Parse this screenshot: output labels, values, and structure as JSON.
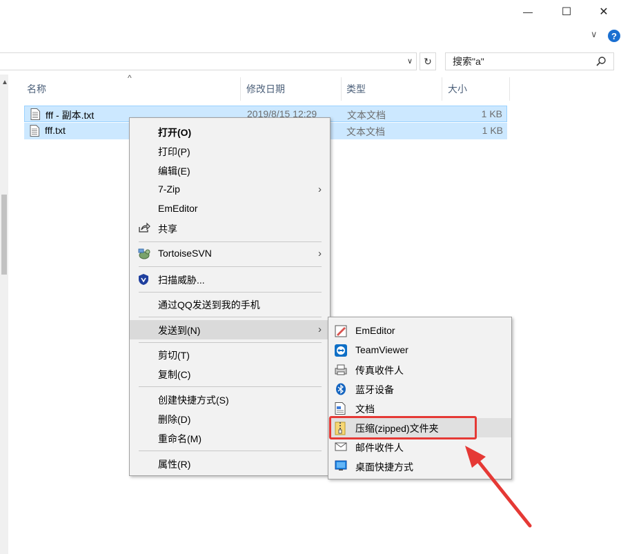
{
  "window": {
    "minimize_glyph": "—",
    "maximize_glyph": "☐",
    "close_glyph": "✕",
    "help_glyph": "?",
    "ribbon_toggle_glyph": "∨"
  },
  "toolbar": {
    "search_placeholder": "搜索\"a\"",
    "refresh_glyph": "↻",
    "dropdown_glyph": "∨"
  },
  "columns": {
    "name": "名称",
    "date": "修改日期",
    "type": "类型",
    "size": "大小",
    "sort_glyph": "^"
  },
  "files": [
    {
      "name": "fff - 副本.txt",
      "date": "2019/8/15 12:29",
      "type": "文本文档",
      "size": "1 KB"
    },
    {
      "name": "fff.txt",
      "date": "",
      "type": "文本文档",
      "size": "1 KB"
    }
  ],
  "context_menu": {
    "items": [
      {
        "label": "打开(O)"
      },
      {
        "label": "打印(P)"
      },
      {
        "label": "编辑(E)"
      },
      {
        "label": "7-Zip"
      },
      {
        "label": "EmEditor"
      },
      {
        "label": "共享"
      },
      {
        "label": "TortoiseSVN"
      },
      {
        "label": "扫描威胁..."
      },
      {
        "label": "通过QQ发送到我的手机"
      },
      {
        "label": "发送到(N)"
      },
      {
        "label": "剪切(T)"
      },
      {
        "label": "复制(C)"
      },
      {
        "label": "创建快捷方式(S)"
      },
      {
        "label": "删除(D)"
      },
      {
        "label": "重命名(M)"
      },
      {
        "label": "属性(R)"
      }
    ],
    "arrow_glyph": "›"
  },
  "send_to_menu": {
    "items": [
      {
        "label": "EmEditor"
      },
      {
        "label": "TeamViewer"
      },
      {
        "label": "传真收件人"
      },
      {
        "label": "蓝牙设备"
      },
      {
        "label": "文档"
      },
      {
        "label": "压缩(zipped)文件夹"
      },
      {
        "label": "邮件收件人"
      },
      {
        "label": "桌面快捷方式"
      }
    ]
  },
  "colors": {
    "selection": "#cce8ff",
    "highlight_box": "#e53935",
    "arrow": "#e53935"
  }
}
